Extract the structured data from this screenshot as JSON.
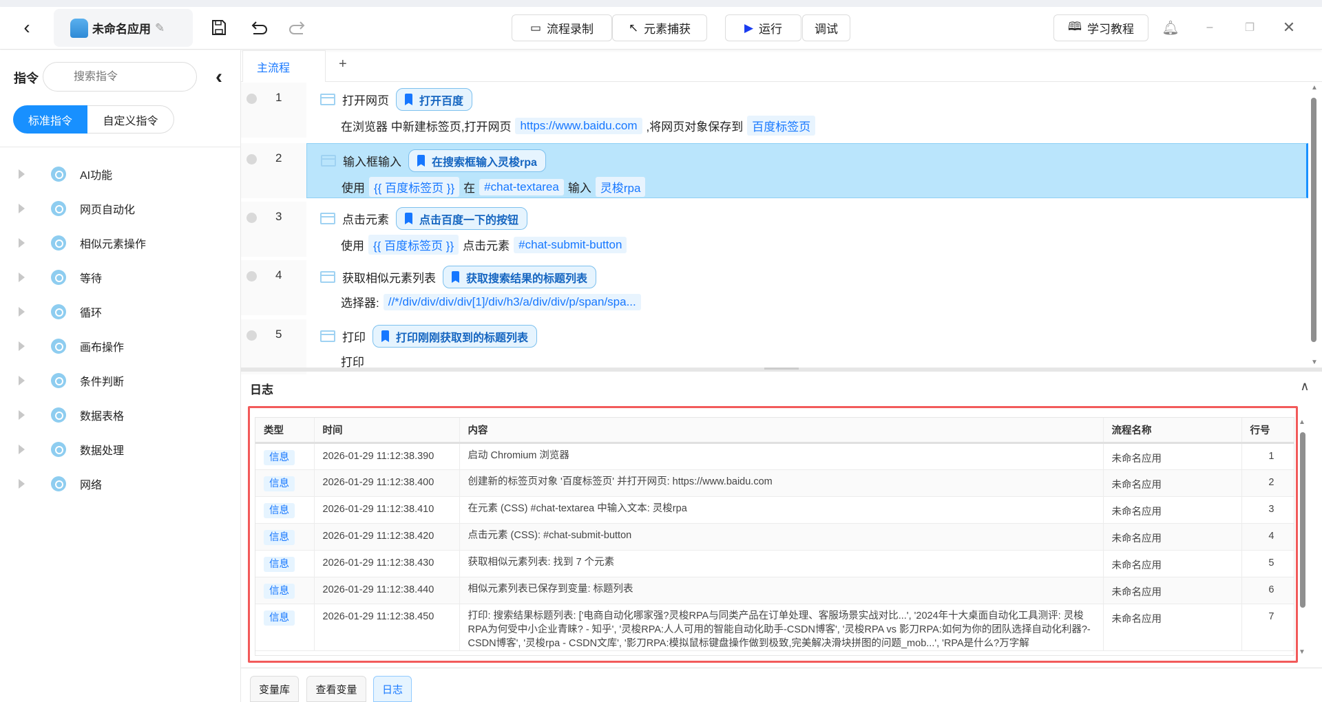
{
  "toolbar": {
    "app_name": "未命名应用",
    "record": "流程录制",
    "capture": "元素捕获",
    "run": "运行",
    "debug": "调试",
    "tutorial": "学习教程"
  },
  "sidebar": {
    "title": "指令",
    "search_placeholder": "搜索指令",
    "tab_standard": "标准指令",
    "tab_custom": "自定义指令",
    "items": [
      "AI功能",
      "网页自动化",
      "相似元素操作",
      "等待",
      "循环",
      "画布操作",
      "条件判断",
      "数据表格",
      "数据处理",
      "网络"
    ]
  },
  "tabs": {
    "main": "主流程",
    "add": "+"
  },
  "flow": [
    {
      "num": "1",
      "name": "打开网页",
      "label": "打开百度",
      "parts": [
        "在浏览器 中新建标签页,打开网页",
        "https://www.baidu.com",
        ",将网页对象保存到",
        "百度标签页"
      ]
    },
    {
      "num": "2",
      "name": "输入框输入",
      "label": "在搜索框输入灵梭rpa",
      "parts": [
        "使用",
        "{{ 百度标签页 }}",
        "在",
        "#chat-textarea",
        "输入",
        "灵梭rpa"
      ]
    },
    {
      "num": "3",
      "name": "点击元素",
      "label": "点击百度一下的按钮",
      "parts": [
        "使用",
        "{{ 百度标签页 }}",
        "点击元素",
        "#chat-submit-button"
      ]
    },
    {
      "num": "4",
      "name": "获取相似元素列表",
      "label": "获取搜索结果的标题列表",
      "parts": [
        "选择器:",
        "//*/div/div/div/div[1]/div/h3/a/div/div/p/span/spa..."
      ]
    },
    {
      "num": "5",
      "name": "打印",
      "label": "打印刚刚获取到的标题列表",
      "parts": [
        "打印"
      ]
    }
  ],
  "log": {
    "title": "日志",
    "columns": [
      "类型",
      "时间",
      "内容",
      "流程名称",
      "行号"
    ],
    "rows": [
      {
        "type": "信息",
        "time": "2026-01-29 11:12:38.390",
        "content": "启动 Chromium 浏览器",
        "flow": "未命名应用",
        "line": "1"
      },
      {
        "type": "信息",
        "time": "2026-01-29 11:12:38.400",
        "content": "创建新的标签页对象 '百度标签页' 并打开网页: https://www.baidu.com",
        "flow": "未命名应用",
        "line": "2"
      },
      {
        "type": "信息",
        "time": "2026-01-29 11:12:38.410",
        "content": "在元素 (CSS) #chat-textarea 中输入文本: 灵梭rpa",
        "flow": "未命名应用",
        "line": "3"
      },
      {
        "type": "信息",
        "time": "2026-01-29 11:12:38.420",
        "content": "点击元素 (CSS): #chat-submit-button",
        "flow": "未命名应用",
        "line": "4"
      },
      {
        "type": "信息",
        "time": "2026-01-29 11:12:38.430",
        "content": "获取相似元素列表: 找到 7 个元素",
        "flow": "未命名应用",
        "line": "5"
      },
      {
        "type": "信息",
        "time": "2026-01-29 11:12:38.440",
        "content": "相似元素列表已保存到变量: 标题列表",
        "flow": "未命名应用",
        "line": "6"
      },
      {
        "type": "信息",
        "time": "2026-01-29 11:12:38.450",
        "content": "打印: 搜索结果标题列表: ['电商自动化哪家强?灵梭RPA与同类产品在订单处理、客服场景实战对比...', '2024年十大桌面自动化工具测评: 灵梭RPA为何受中小企业青睐? - 知乎', '灵梭RPA:人人可用的智能自动化助手-CSDN博客', '灵梭RPA vs 影刀RPA:如何为你的团队选择自动化利器?-CSDN博客', '灵梭rpa - CSDN文库', '影刀RPA:模拟鼠标键盘操作做到极致,完美解决滑块拼图的问题_mob...', 'RPA是什么?万字解",
        "flow": "未命名应用",
        "line": "7"
      }
    ]
  },
  "bottom": {
    "vars": "变量库",
    "view_vars": "查看变量",
    "log": "日志"
  },
  "colors": {
    "accent": "#1677ff",
    "selected_row": "#bae5fc",
    "highlight_border": "#f25a5a"
  }
}
